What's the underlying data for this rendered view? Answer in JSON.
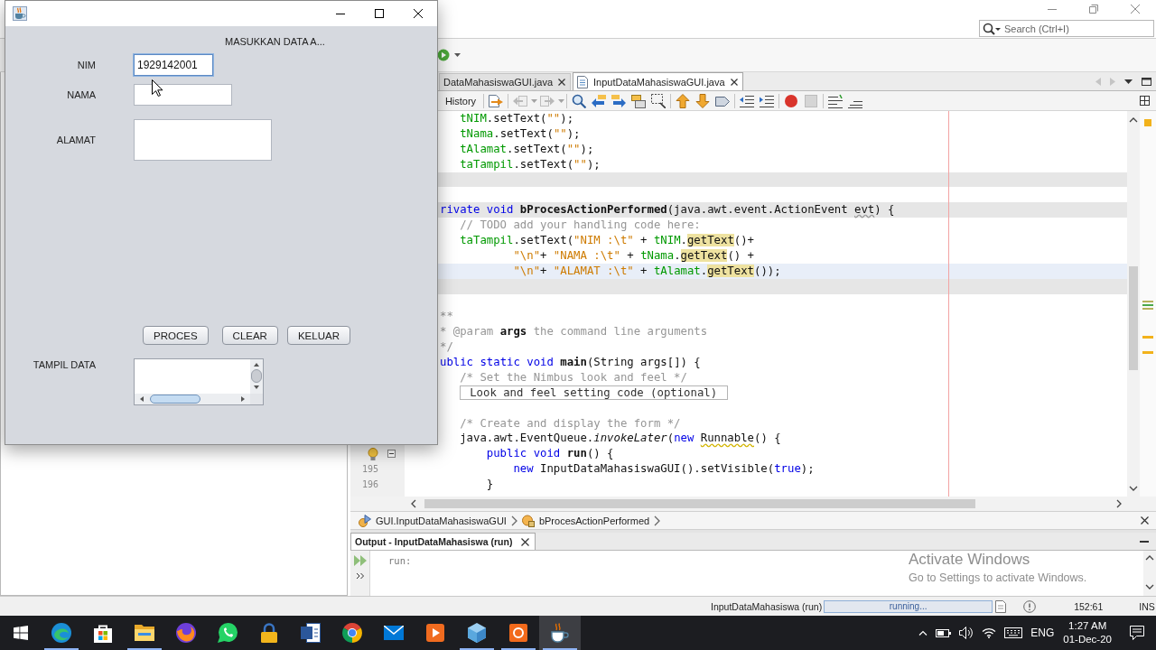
{
  "ide": {
    "search": {
      "placeholder": "Search (Ctrl+I)"
    },
    "editor_tabs": [
      {
        "label": "DataMahasiswaGUI.java",
        "selected": false
      },
      {
        "label": "InputDataMahasiswaGUI.java",
        "selected": true
      }
    ],
    "editor_toolbar": {
      "history": "History",
      "tools": [
        {
          "disabled": false
        },
        {
          "disabled": true
        },
        {
          "disabled": true
        },
        {
          "disabled": false
        },
        {
          "disabled": false
        },
        {
          "disabled": false
        },
        {
          "disabled": false
        },
        {
          "disabled": false
        },
        {
          "disabled": false
        },
        {
          "disabled": false
        },
        {
          "disabled": false
        },
        {
          "disabled": false
        },
        {
          "disabled": false
        },
        {
          "disabled": false
        },
        {
          "disabled": true
        },
        {
          "disabled": false
        },
        {
          "disabled": false
        }
      ]
    },
    "code_lines": [
      {
        "guarded": false,
        "current": false,
        "hint": false,
        "foldable": false,
        "tokens": [
          {
            "kind": "field",
            "text": "   tNIM"
          },
          {
            "kind": "plain",
            "text": ".setText("
          },
          {
            "kind": "str",
            "text": "\"\""
          },
          {
            "kind": "plain",
            "text": ");"
          }
        ]
      },
      {
        "guarded": false,
        "current": false,
        "hint": false,
        "foldable": false,
        "tokens": [
          {
            "kind": "field",
            "text": "   tNama"
          },
          {
            "kind": "plain",
            "text": ".setText("
          },
          {
            "kind": "str",
            "text": "\"\""
          },
          {
            "kind": "plain",
            "text": ");"
          }
        ]
      },
      {
        "guarded": false,
        "current": false,
        "hint": false,
        "foldable": false,
        "tokens": [
          {
            "kind": "field",
            "text": "   tAlamat"
          },
          {
            "kind": "plain",
            "text": ".setText("
          },
          {
            "kind": "str",
            "text": "\"\""
          },
          {
            "kind": "plain",
            "text": ");"
          }
        ]
      },
      {
        "guarded": false,
        "current": false,
        "hint": false,
        "foldable": false,
        "tokens": [
          {
            "kind": "field",
            "text": "   taTampil"
          },
          {
            "kind": "plain",
            "text": ".setText("
          },
          {
            "kind": "str",
            "text": "\"\""
          },
          {
            "kind": "plain",
            "text": ");"
          }
        ]
      },
      {
        "guarded": true,
        "current": false,
        "hint": false,
        "foldable": false
      },
      {
        "guarded": false,
        "current": false,
        "hint": false,
        "foldable": false
      },
      {
        "guarded": true,
        "current": false,
        "hint": false,
        "foldable": false,
        "tokens": [
          {
            "kind": "kw",
            "text": "rivate void "
          },
          {
            "kind": "bold",
            "text": "bProcesActionPerformed"
          },
          {
            "kind": "plain",
            "text": "(java.awt.event.ActionEvent "
          },
          {
            "kind": "warn",
            "text": "evt"
          },
          {
            "kind": "plain",
            "text": ") {"
          }
        ]
      },
      {
        "guarded": false,
        "current": false,
        "hint": false,
        "foldable": false,
        "tokens": [
          {
            "kind": "comment",
            "text": "   // TODO add your handling code here:"
          }
        ]
      },
      {
        "guarded": false,
        "current": false,
        "hint": false,
        "foldable": false,
        "tokens": [
          {
            "kind": "field",
            "text": "   taTampil"
          },
          {
            "kind": "plain",
            "text": ".setText("
          },
          {
            "kind": "str",
            "text": "\"NIM :\\t\""
          },
          {
            "kind": "plain",
            "text": " + "
          },
          {
            "kind": "field",
            "text": "tNIM"
          },
          {
            "kind": "plain",
            "text": "."
          },
          {
            "kind": "hl",
            "text": "getText"
          },
          {
            "kind": "plain",
            "text": "()+"
          }
        ]
      },
      {
        "guarded": false,
        "current": false,
        "hint": false,
        "foldable": false,
        "tokens": [
          {
            "kind": "str",
            "text": "           \"\\n\""
          },
          {
            "kind": "plain",
            "text": "+ "
          },
          {
            "kind": "str",
            "text": "\"NAMA :\\t\""
          },
          {
            "kind": "plain",
            "text": " + "
          },
          {
            "kind": "field",
            "text": "tNama"
          },
          {
            "kind": "plain",
            "text": "."
          },
          {
            "kind": "hl",
            "text": "getText"
          },
          {
            "kind": "plain",
            "text": "() +"
          }
        ]
      },
      {
        "guarded": false,
        "current": true,
        "hint": false,
        "foldable": false,
        "tokens": [
          {
            "kind": "str",
            "text": "           \"\\n\""
          },
          {
            "kind": "plain",
            "text": "+ "
          },
          {
            "kind": "str",
            "text": "\"ALAMAT :\\t\""
          },
          {
            "kind": "plain",
            "text": " + "
          },
          {
            "kind": "field",
            "text": "tAlamat"
          },
          {
            "kind": "plain",
            "text": "."
          },
          {
            "kind": "hl",
            "text": "getText"
          },
          {
            "kind": "plain",
            "text": "());"
          }
        ]
      },
      {
        "guarded": true,
        "current": false,
        "hint": false,
        "foldable": false
      },
      {
        "guarded": false,
        "current": false,
        "hint": false,
        "foldable": false
      },
      {
        "guarded": false,
        "current": false,
        "hint": false,
        "foldable": false,
        "tokens": [
          {
            "kind": "comment",
            "text": "**"
          }
        ]
      },
      {
        "guarded": false,
        "current": false,
        "hint": false,
        "foldable": false,
        "tokens": [
          {
            "kind": "comment",
            "text": "* @param "
          },
          {
            "kind": "bold",
            "text": "args"
          },
          {
            "kind": "comment",
            "text": " the command line arguments"
          }
        ]
      },
      {
        "guarded": false,
        "current": false,
        "hint": false,
        "foldable": false,
        "tokens": [
          {
            "kind": "comment",
            "text": "*/"
          }
        ]
      },
      {
        "guarded": false,
        "current": false,
        "hint": false,
        "foldable": false,
        "tokens": [
          {
            "kind": "kw",
            "text": "ublic static void "
          },
          {
            "kind": "bold",
            "text": "main"
          },
          {
            "kind": "plain",
            "text": "(String args[]) {"
          }
        ]
      },
      {
        "guarded": false,
        "current": false,
        "hint": false,
        "foldable": false,
        "tokens": [
          {
            "kind": "comment",
            "text": "   /* Set the Nimbus look and feel */"
          }
        ]
      },
      {
        "guarded": false,
        "current": false,
        "hint": false,
        "foldable": false,
        "tokens": [
          {
            "kind": "fold",
            "text": "   Look and feel setting code (optional)"
          }
        ]
      },
      {
        "guarded": false,
        "current": false,
        "hint": false,
        "foldable": false
      },
      {
        "guarded": false,
        "current": false,
        "hint": false,
        "foldable": false,
        "tokens": [
          {
            "kind": "comment",
            "text": "   /* Create and display the form */"
          }
        ]
      },
      {
        "guarded": false,
        "current": false,
        "hint": false,
        "foldable": false,
        "tokens": [
          {
            "kind": "plain",
            "text": "   java.awt.EventQueue."
          },
          {
            "kind": "italic",
            "text": "invokeLater"
          },
          {
            "kind": "plain",
            "text": "("
          },
          {
            "kind": "kw",
            "text": "new "
          },
          {
            "kind": "hint",
            "text": "Runnable"
          },
          {
            "kind": "plain",
            "text": "() {"
          }
        ]
      },
      {
        "guarded": false,
        "current": false,
        "hint": true,
        "foldable": true,
        "tokens": [
          {
            "kind": "kw",
            "text": "       public void "
          },
          {
            "kind": "bold",
            "text": "run"
          },
          {
            "kind": "plain",
            "text": "() {"
          }
        ]
      },
      {
        "guarded": false,
        "current": false,
        "hint": false,
        "foldable": false,
        "number": "195",
        "tokens": [
          {
            "kind": "kw",
            "text": "           new"
          },
          {
            "kind": "plain",
            "text": " InputDataMahasiswaGUI().setVisible("
          },
          {
            "kind": "kw",
            "text": "true"
          },
          {
            "kind": "plain",
            "text": ");"
          }
        ]
      },
      {
        "guarded": false,
        "current": false,
        "hint": false,
        "foldable": false,
        "number": "196",
        "tokens": [
          {
            "kind": "plain",
            "text": "       }"
          }
        ]
      }
    ],
    "breadcrumbs": [
      "GUI.InputDataMahasiswaGUI",
      "bProcesActionPerformed"
    ],
    "output": {
      "title": "Output - InputDataMahasiswa (run)",
      "lines": [
        "run:"
      ]
    },
    "status_bar": {
      "task": "InputDataMahasiswa (run)",
      "progress": {
        "text": "running...",
        "level": 1
      },
      "position": "152:61",
      "mode": "INS"
    }
  },
  "activation_notice": {
    "title": "Activate Windows",
    "message": "Go to Settings to activate Windows."
  },
  "form": {
    "header": "MASUKKAN DATA A...",
    "fields": [
      {
        "label": "NIM",
        "value": "1929142001",
        "focused": true
      },
      {
        "label": "NAMA",
        "focused": false
      },
      {
        "label": "ALAMAT",
        "focused": false
      }
    ],
    "buttons": [
      "PROCES",
      "CLEAR",
      "KELUAR"
    ],
    "output_area": {
      "label": "TAMPIL DATA"
    }
  },
  "taskbar": {
    "apps": [
      {
        "active": false,
        "running": true
      },
      {
        "active": false,
        "running": false
      },
      {
        "active": false,
        "running": true
      },
      {
        "active": false,
        "running": false
      },
      {
        "active": false,
        "running": false
      },
      {
        "active": false,
        "running": false
      },
      {
        "active": false,
        "running": false
      },
      {
        "active": false,
        "running": false
      },
      {
        "active": false,
        "running": false
      },
      {
        "active": false,
        "running": false
      },
      {
        "active": false,
        "running": true
      },
      {
        "active": false,
        "running": true
      },
      {
        "active": true,
        "running": true
      }
    ],
    "language": "ENG",
    "time": "1:27 AM",
    "date": "01-Dec-20"
  }
}
